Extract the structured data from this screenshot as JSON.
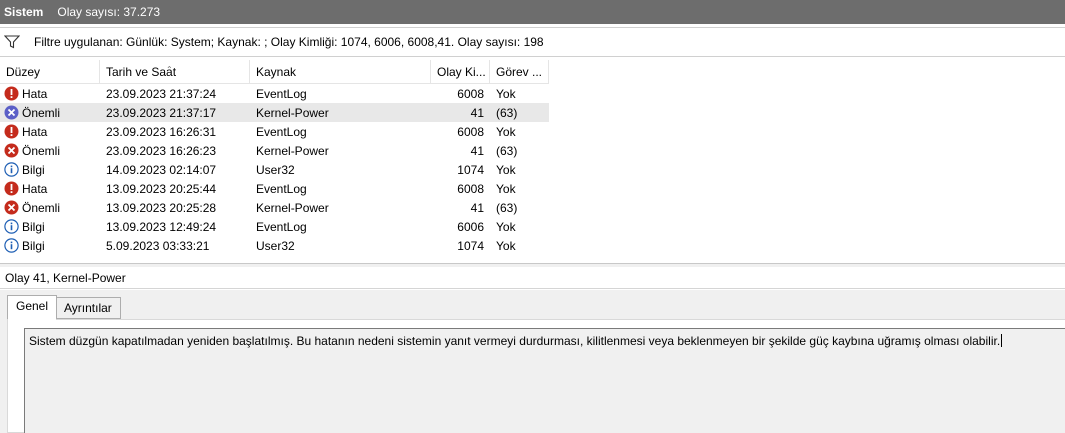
{
  "window": {
    "title": "Sistem",
    "count_label": "Olay sayısı: 37.273"
  },
  "filter": {
    "icon": "filter-icon",
    "text": "Filtre uygulanan: Günlük: System; Kaynak: ; Olay Kimliği: 1074, 6006, 6008,41. Olay sayısı: 198"
  },
  "grid": {
    "columns": [
      "Düzey",
      "Tarih ve Saat",
      "Kaynak",
      "Olay Ki...",
      "Görev ..."
    ],
    "rows": [
      {
        "level": "Hata",
        "icon": "error-icon",
        "datetime": "23.09.2023 21:37:24",
        "source": "EventLog",
        "event_id": "6008",
        "task": "Yok"
      },
      {
        "level": "Önemli",
        "icon": "critical-icon",
        "datetime": "23.09.2023 21:37:17",
        "source": "Kernel-Power",
        "event_id": "41",
        "task": "(63)"
      },
      {
        "level": "Hata",
        "icon": "error-icon",
        "datetime": "23.09.2023 16:26:31",
        "source": "EventLog",
        "event_id": "6008",
        "task": "Yok"
      },
      {
        "level": "Önemli",
        "icon": "critical-icon",
        "datetime": "23.09.2023 16:26:23",
        "source": "Kernel-Power",
        "event_id": "41",
        "task": "(63)"
      },
      {
        "level": "Bilgi",
        "icon": "info-icon",
        "datetime": "14.09.2023 02:14:07",
        "source": "User32",
        "event_id": "1074",
        "task": "Yok"
      },
      {
        "level": "Hata",
        "icon": "error-icon",
        "datetime": "13.09.2023 20:25:44",
        "source": "EventLog",
        "event_id": "6008",
        "task": "Yok"
      },
      {
        "level": "Önemli",
        "icon": "critical-icon",
        "datetime": "13.09.2023 20:25:28",
        "source": "Kernel-Power",
        "event_id": "41",
        "task": "(63)"
      },
      {
        "level": "Bilgi",
        "icon": "info-icon",
        "datetime": "13.09.2023 12:49:24",
        "source": "EventLog",
        "event_id": "6006",
        "task": "Yok"
      },
      {
        "level": "Bilgi",
        "icon": "info-icon",
        "datetime": "5.09.2023 03:33:21",
        "source": "User32",
        "event_id": "1074",
        "task": "Yok"
      }
    ]
  },
  "detail": {
    "title": "Olay 41, Kernel-Power",
    "tabs": [
      "Genel",
      "Ayrıntılar"
    ],
    "description": "Sistem düzgün kapatılmadan yeniden başlatılmış. Bu hatanın nedeni sistemin yanıt vermeyi durdurması, kilitlenmesi veya beklenmeyen bir şekilde güç kaybına uğramış olması olabilir."
  },
  "colors": {
    "titlebar": "#6d6d6d",
    "error": "#c42b1c",
    "critical": "#5b5fc7",
    "info": "#ffffff",
    "selected_row": "#e8e8e8"
  }
}
